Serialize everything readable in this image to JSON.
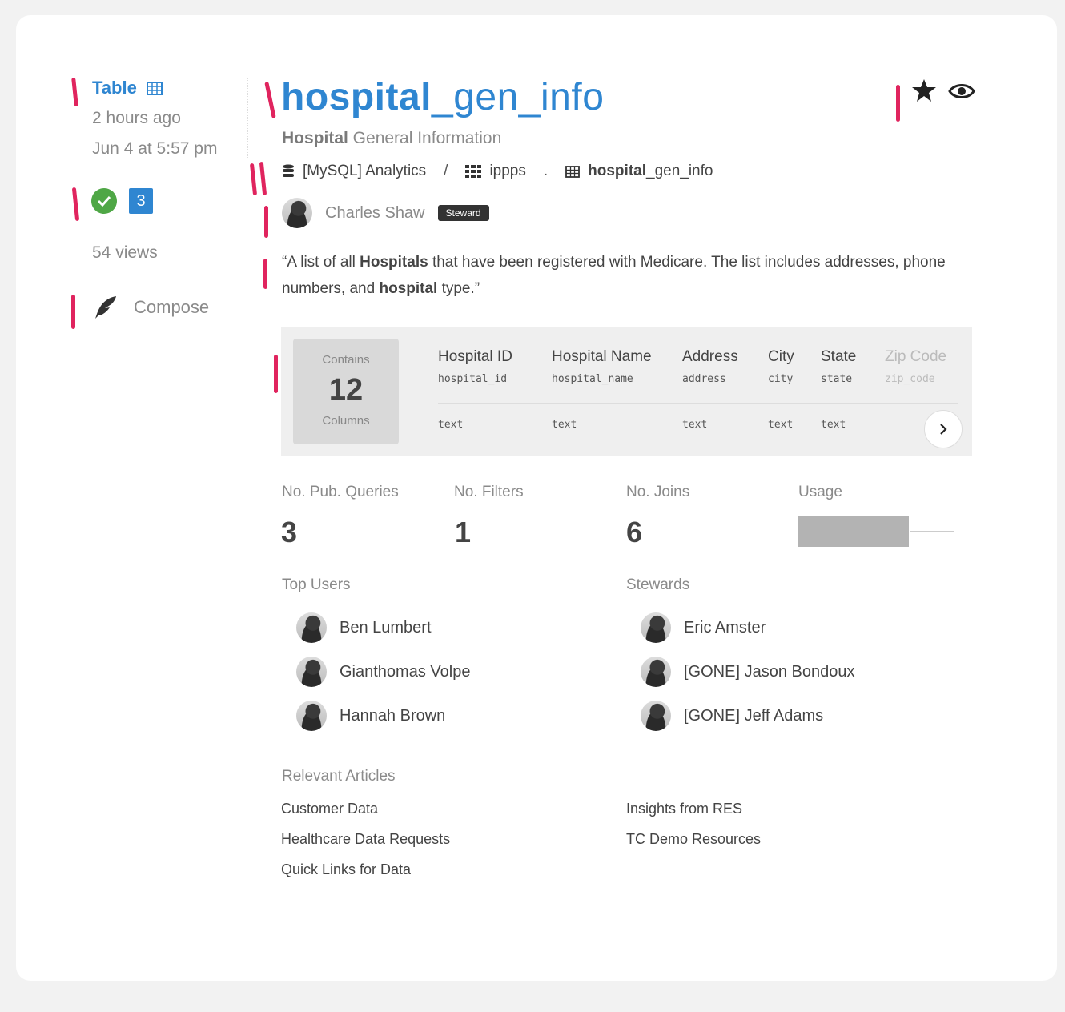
{
  "sidebar": {
    "type_label": "Table",
    "updated_relative": "2 hours ago",
    "updated_date": "Jun 4 at 5:57 pm",
    "badge_count": "3",
    "views": "54 views",
    "compose_label": "Compose"
  },
  "header": {
    "title_bold": "hospital",
    "title_rest": "_gen_info",
    "subtitle_bold": "Hospital",
    "subtitle_rest": " General Information"
  },
  "path": {
    "datasource": "[MySQL] Analytics",
    "separator1": "/",
    "schema": "ippps",
    "separator2": ".",
    "table_bold": "hospital",
    "table_rest": "_gen_info"
  },
  "owner": {
    "name": "Charles Shaw",
    "badge": "Steward"
  },
  "description": {
    "p1": "“A list of all ",
    "b1": "Hospitals",
    "p2": " that have been registered with Medicare. The list includes addresses, phone numbers, and ",
    "b2": "hospital",
    "p3": " type.”"
  },
  "columns_panel": {
    "contains_label": "Contains",
    "count": "12",
    "columns_label": "Columns",
    "columns": [
      {
        "name": "Hospital ID",
        "field": "hospital_id",
        "type": "text"
      },
      {
        "name": "Hospital Name",
        "field": "hospital_name",
        "type": "text"
      },
      {
        "name": "Address",
        "field": "address",
        "type": "text"
      },
      {
        "name": "City",
        "field": "city",
        "type": "text"
      },
      {
        "name": "State",
        "field": "state",
        "type": "text"
      },
      {
        "name": "Zip Code",
        "field": "zip_code",
        "type": "text"
      }
    ]
  },
  "stats": {
    "pub_queries_label": "No. Pub. Queries",
    "pub_queries": "3",
    "filters_label": "No. Filters",
    "filters": "1",
    "joins_label": "No. Joins",
    "joins": "6",
    "usage_label": "Usage",
    "usage_fraction": 0.71
  },
  "top_users": {
    "label": "Top Users",
    "users": [
      "Ben Lumbert",
      "Gianthomas Volpe",
      "Hannah Brown"
    ]
  },
  "stewards": {
    "label": "Stewards",
    "users": [
      "Eric Amster",
      "[GONE] Jason Bondoux",
      "[GONE] Jeff Adams"
    ]
  },
  "articles": {
    "label": "Relevant Articles",
    "left": [
      "Customer Data",
      "Healthcare Data Requests",
      "Quick Links for Data"
    ],
    "right": [
      "Insights from RES",
      "TC Demo Resources"
    ]
  },
  "colors": {
    "accent": "#2f86d1",
    "success": "#4fa746",
    "annotation": "#e0245e"
  }
}
